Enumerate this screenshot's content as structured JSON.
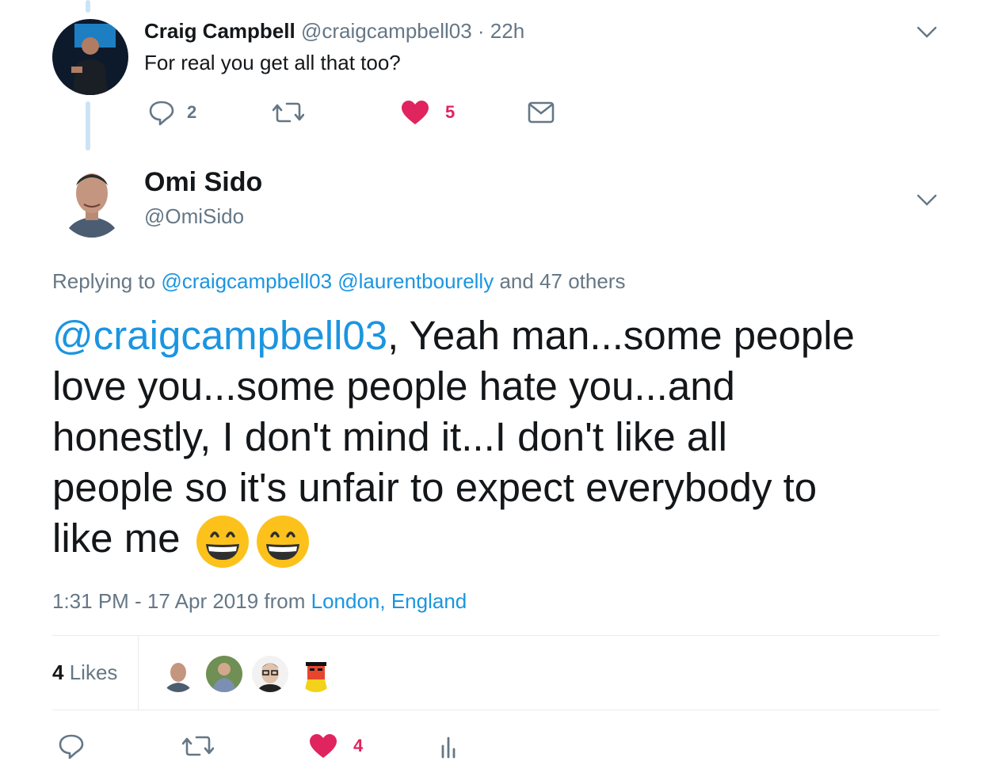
{
  "reply_tweet": {
    "author_name": "Craig Campbell",
    "handle_time": "@craigcampbell03 · 22h",
    "text": "For real you get all that too?",
    "reply_count": "2",
    "like_count": "5"
  },
  "main_tweet": {
    "author_name": "Omi Sido",
    "author_handle": "@OmiSido",
    "replying_prefix": "Replying to",
    "replying_mention_1": "@craigcampbell03",
    "replying_mention_2": "@laurentbourelly",
    "replying_suffix": "and 47 others",
    "body_mention": "@craigcampbell03",
    "body_text_1": ", Yeah man...some people",
    "body_line_2": "love you...some people hate you...and",
    "body_line_3": "honestly, I don't mind it...I don't like all",
    "body_line_4": "people so it's unfair to expect everybody to",
    "body_line_5": "like me",
    "timestamp": "1:31 PM - 17 Apr 2019 from",
    "location": "London, England",
    "likes_count": "4",
    "likes_label": "Likes",
    "action_like_count": "4"
  },
  "icons": [
    "reply-icon",
    "retweet-icon",
    "heart-icon",
    "mail-icon",
    "chevron-down-icon",
    "analytics-icon",
    "grinning-emoji"
  ],
  "colors": {
    "link": "#1b95e0",
    "like": "#e0245e",
    "muted": "#657786",
    "thread": "#cce3f5"
  }
}
